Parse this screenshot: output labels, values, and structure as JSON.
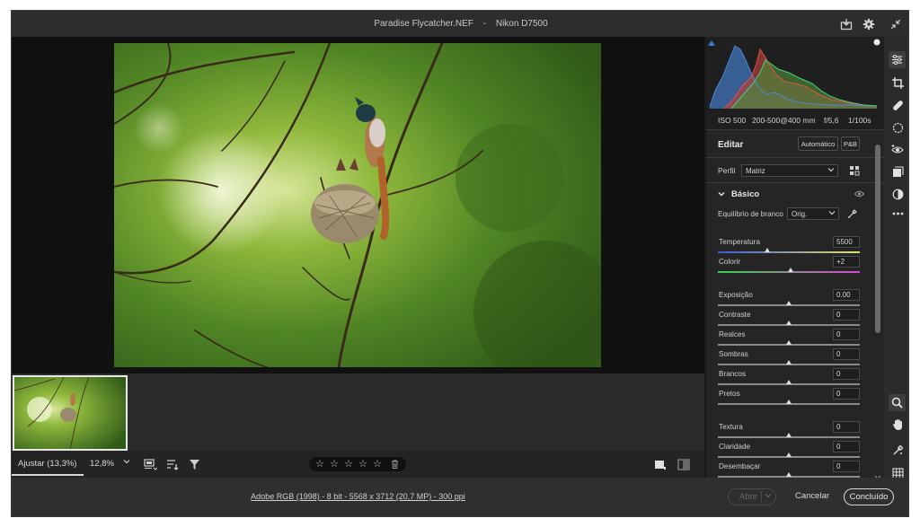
{
  "titlebar": {
    "filename": "Paradise Flycatcher.NEF",
    "separator": "-",
    "camera": "Nikon D7500"
  },
  "histogram": {
    "iso": "ISO 500",
    "lens": "200-500@400 mm",
    "aperture": "f/5,6",
    "shutter": "1/100s"
  },
  "panel": {
    "editar_label": "Editar",
    "auto_button": "Automático",
    "bw_button": "P&B",
    "profile_label": "Perfil",
    "profile_value": "Matriz",
    "basic_section": "Básico",
    "white_balance_label": "Equilíbrio de branco",
    "white_balance_value": "Orig.",
    "sliders": [
      {
        "name": "Temperatura",
        "value": "5500",
        "position": 0.35,
        "gradient": "temp"
      },
      {
        "name": "Colorir",
        "value": "+2",
        "position": 0.51,
        "gradient": "tint"
      },
      {
        "name": "Exposição",
        "value": "0.00",
        "position": 0.5,
        "gradient": "none"
      },
      {
        "name": "Contraste",
        "value": "0",
        "position": 0.5,
        "gradient": "none"
      },
      {
        "name": "Realces",
        "value": "0",
        "position": 0.5,
        "gradient": "none"
      },
      {
        "name": "Sombras",
        "value": "0",
        "position": 0.5,
        "gradient": "none"
      },
      {
        "name": "Brancos",
        "value": "0",
        "position": 0.5,
        "gradient": "none"
      },
      {
        "name": "Pretos",
        "value": "0",
        "position": 0.5,
        "gradient": "none"
      },
      {
        "name": "Textura",
        "value": "0",
        "position": 0.5,
        "gradient": "none"
      },
      {
        "name": "Claridade",
        "value": "0",
        "position": 0.5,
        "gradient": "none"
      },
      {
        "name": "Desembaçar",
        "value": "0",
        "position": 0.5,
        "gradient": "none"
      }
    ]
  },
  "viewbar": {
    "zoom_fit": "Ajustar (13,3%)",
    "zoom_value": "12,8%"
  },
  "bottom": {
    "file_info": "Adobe RGB (1998) - 8 bit - 5568 x 3712 (20,7 MP) - 300 ppi",
    "open_button": "Abrir",
    "cancel_button": "Cancelar",
    "done_button": "Concluído"
  },
  "colors": {
    "accent": "#1473e6",
    "background": "#1b1b1b",
    "panel": "#252525"
  }
}
